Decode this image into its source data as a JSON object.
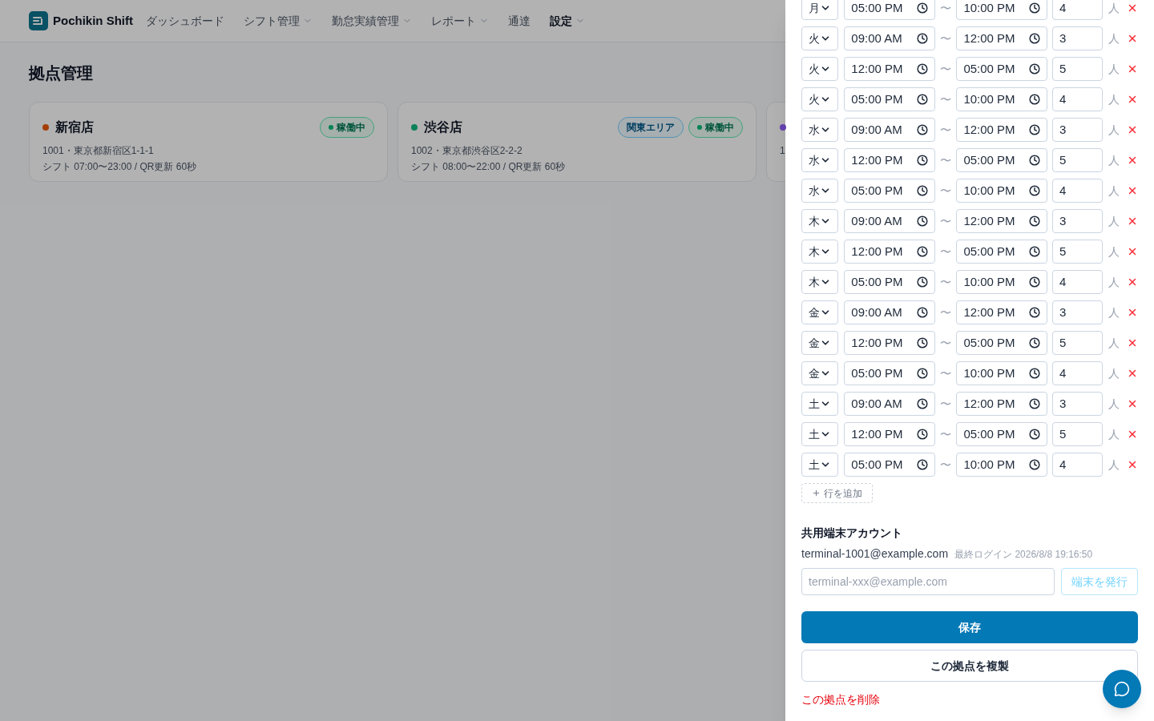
{
  "header": {
    "logo": "Pochikin Shift",
    "nav": [
      {
        "label": "ダッシュボード",
        "dropdown": false,
        "selected": false
      },
      {
        "label": "シフト管理",
        "dropdown": true,
        "selected": false
      },
      {
        "label": "勤怠実績管理",
        "dropdown": true,
        "selected": false
      },
      {
        "label": "レポート",
        "dropdown": true,
        "selected": false
      },
      {
        "label": "通達",
        "dropdown": false,
        "selected": false
      },
      {
        "label": "設定",
        "dropdown": true,
        "selected": true
      }
    ]
  },
  "page": {
    "title": "拠点管理",
    "locations": [
      {
        "name": "新宿店",
        "color": "#a43e08",
        "address": "1001・東京都新宿区1-1-1",
        "shift": "シフト 07:00〜23:00 / QR更新 60秒",
        "badges": [
          {
            "label": "稼働中",
            "kind": "status"
          }
        ]
      },
      {
        "name": "渋谷店",
        "color": "#0b825a",
        "address": "1002・東京都渋谷区2-2-2",
        "shift": "シフト 08:00〜22:00 / QR更新 60秒",
        "badges": [
          {
            "label": "関東エリア",
            "kind": "area"
          },
          {
            "label": "稼働中",
            "kind": "status"
          }
        ]
      },
      {
        "color": "#6140ac",
        "address": "1"
      }
    ]
  },
  "drawer": {
    "shift_rows": [
      {
        "day": "月",
        "start": "05:00 PM",
        "sep": "〜",
        "end": "10:00 PM",
        "count": "4",
        "unit": "人"
      },
      {
        "day": "火",
        "start": "09:00 AM",
        "sep": "〜",
        "end": "12:00 PM",
        "count": "3",
        "unit": "人"
      },
      {
        "day": "火",
        "start": "12:00 PM",
        "sep": "〜",
        "end": "05:00 PM",
        "count": "5",
        "unit": "人"
      },
      {
        "day": "火",
        "start": "05:00 PM",
        "sep": "〜",
        "end": "10:00 PM",
        "count": "4",
        "unit": "人"
      },
      {
        "day": "水",
        "start": "09:00 AM",
        "sep": "〜",
        "end": "12:00 PM",
        "count": "3",
        "unit": "人"
      },
      {
        "day": "水",
        "start": "12:00 PM",
        "sep": "〜",
        "end": "05:00 PM",
        "count": "5",
        "unit": "人"
      },
      {
        "day": "水",
        "start": "05:00 PM",
        "sep": "〜",
        "end": "10:00 PM",
        "count": "4",
        "unit": "人"
      },
      {
        "day": "木",
        "start": "09:00 AM",
        "sep": "〜",
        "end": "12:00 PM",
        "count": "3",
        "unit": "人"
      },
      {
        "day": "木",
        "start": "12:00 PM",
        "sep": "〜",
        "end": "05:00 PM",
        "count": "5",
        "unit": "人"
      },
      {
        "day": "木",
        "start": "05:00 PM",
        "sep": "〜",
        "end": "10:00 PM",
        "count": "4",
        "unit": "人"
      },
      {
        "day": "金",
        "start": "09:00 AM",
        "sep": "〜",
        "end": "12:00 PM",
        "count": "3",
        "unit": "人"
      },
      {
        "day": "金",
        "start": "12:00 PM",
        "sep": "〜",
        "end": "05:00 PM",
        "count": "5",
        "unit": "人"
      },
      {
        "day": "金",
        "start": "05:00 PM",
        "sep": "〜",
        "end": "10:00 PM",
        "count": "4",
        "unit": "人"
      },
      {
        "day": "土",
        "start": "09:00 AM",
        "sep": "〜",
        "end": "12:00 PM",
        "count": "3",
        "unit": "人"
      },
      {
        "day": "土",
        "start": "12:00 PM",
        "sep": "〜",
        "end": "05:00 PM",
        "count": "5",
        "unit": "人"
      },
      {
        "day": "土",
        "start": "05:00 PM",
        "sep": "〜",
        "end": "10:00 PM",
        "count": "4",
        "unit": "人"
      }
    ],
    "add_row": "行を追加",
    "terminal": {
      "heading": "共用端末アカウント",
      "account": "terminal-1001@example.com",
      "last_login": "最終ログイン 2026/8/8 19:16:50",
      "placeholder": "terminal-xxx@example.com",
      "issue_button": "端末を発行"
    },
    "save_button": "保存",
    "duplicate_button": "この拠点を複製",
    "delete_link": "この拠点を削除"
  }
}
